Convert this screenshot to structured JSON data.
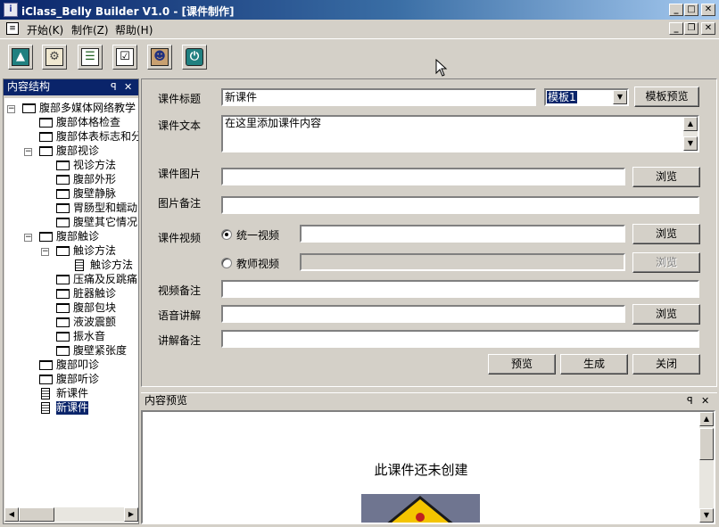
{
  "window": {
    "title": "iClass_Belly Builder V1.0  - [课件制作]",
    "app_icon": "app-icon",
    "controls": [
      "minimize-icon",
      "maximize-icon",
      "close-icon"
    ]
  },
  "menubar": {
    "items": [
      {
        "label": "开始(K)"
      },
      {
        "label": "制作(Z)"
      },
      {
        "label": "帮助(H)"
      }
    ]
  },
  "toolbar": {
    "buttons": [
      {
        "icon": "navigate-icon"
      },
      {
        "icon": "settings-icon"
      },
      {
        "icon": "list-icon"
      },
      {
        "icon": "checklist-icon"
      },
      {
        "icon": "people-icon"
      },
      {
        "icon": "power-icon"
      }
    ]
  },
  "tree_panel": {
    "title": "内容结构",
    "pin": "ꟼ",
    "close": "✕",
    "nodes": [
      {
        "label": "腹部多媒体网络教学",
        "type": "folder",
        "expander": "−"
      },
      {
        "label": "腹部体格检查",
        "type": "folder"
      },
      {
        "label": "腹部体表标志和分",
        "type": "folder"
      },
      {
        "label": "腹部视诊",
        "type": "folder",
        "expander": "−"
      },
      {
        "label": "视诊方法",
        "type": "folder"
      },
      {
        "label": "腹部外形",
        "type": "folder"
      },
      {
        "label": "腹壁静脉",
        "type": "folder"
      },
      {
        "label": "胃肠型和蠕动",
        "type": "folder"
      },
      {
        "label": "腹壁其它情况",
        "type": "folder"
      },
      {
        "label": "腹部触诊",
        "type": "folder",
        "expander": "−"
      },
      {
        "label": "触诊方法",
        "type": "folder",
        "expander": "−"
      },
      {
        "label": "触诊方法",
        "type": "doc"
      },
      {
        "label": "压痛及反跳痛",
        "type": "folder"
      },
      {
        "label": "脏器触诊",
        "type": "folder"
      },
      {
        "label": "腹部包块",
        "type": "folder"
      },
      {
        "label": "液波震颤",
        "type": "folder"
      },
      {
        "label": "振水音",
        "type": "folder"
      },
      {
        "label": "腹壁紧张度",
        "type": "folder"
      },
      {
        "label": "腹部叩诊",
        "type": "folder"
      },
      {
        "label": "腹部听诊",
        "type": "folder"
      },
      {
        "label": "新课件",
        "type": "doc"
      },
      {
        "label": "新课件",
        "type": "doc",
        "selected": true
      }
    ]
  },
  "form": {
    "title_label": "课件标题",
    "title_value": "新课件",
    "template_value": "模板1",
    "template_preview_button": "模板预览",
    "text_label": "课件文本",
    "text_value": "在这里添加课件内容",
    "image_label": "课件图片",
    "image_value": "",
    "browse_label": "浏览",
    "image_note_label": "图片备注",
    "image_note_value": "",
    "video_label": "课件视频",
    "video_option_unified": "统一视频",
    "video_option_teacher": "教师视频",
    "video_note_label": "视频备注",
    "audio_label": "语音讲解",
    "audio_note_label": "讲解备注",
    "preview_button": "预览",
    "generate_button": "生成",
    "close_button": "关闭"
  },
  "preview_panel": {
    "title": "内容预览",
    "pin": "ꟼ",
    "close": "✕",
    "message": "此课件还未创建",
    "image_icon": "warning-sign-icon"
  },
  "colors": {
    "accent": "#0a246a",
    "window_bg": "#d4d0c8",
    "title_gradient_end": "#a6caf0"
  }
}
